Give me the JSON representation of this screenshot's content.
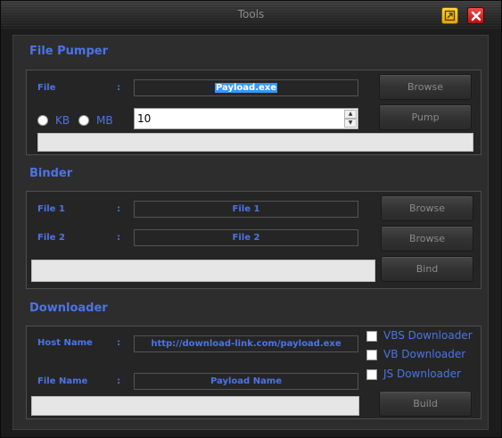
{
  "window": {
    "title": "Tools",
    "colors": {
      "accent": "#4c74e6",
      "minimize": "#f5c000",
      "close": "#d42020"
    },
    "icons": {
      "minimize": "restore-icon",
      "close": "close-icon"
    }
  },
  "file_pumper": {
    "title": "File Pumper",
    "file_label": "File",
    "colon": ":",
    "file_value": "Payload.exe",
    "browse_label": "Browse",
    "kb_label": "KB",
    "mb_label": "MB",
    "size_value": "10",
    "pump_label": "Pump"
  },
  "binder": {
    "title": "Binder",
    "file1_label": "File 1",
    "file1_value": "File 1",
    "file2_label": "File 2",
    "file2_value": "File 2",
    "colon": ":",
    "browse1_label": "Browse",
    "browse2_label": "Browse",
    "bind_label": "Bind"
  },
  "downloader": {
    "title": "Downloader",
    "host_label": "Host Name",
    "host_value": "http://download-link.com/payload.exe",
    "filename_label": "File Name",
    "filename_value": "Payload Name",
    "colon": ":",
    "options": [
      "VBS Downloader",
      "VB Downloader",
      "JS Downloader"
    ],
    "build_label": "Build"
  }
}
